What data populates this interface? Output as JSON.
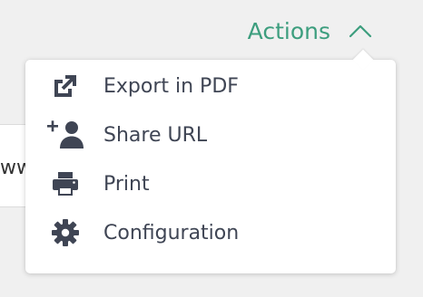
{
  "background": {
    "field_partial_text": "ww"
  },
  "actions": {
    "label": "Actions",
    "accent_color": "#3d9e7e",
    "chevron_icon": "chevron-up-icon"
  },
  "menu": {
    "items": [
      {
        "label": "Export in PDF",
        "icon": "external-link-icon"
      },
      {
        "label": "Share URL",
        "icon": "add-user-icon"
      },
      {
        "label": "Print",
        "icon": "printer-icon"
      },
      {
        "label": "Configuration",
        "icon": "gear-icon"
      }
    ],
    "icon_color": "#3f4554"
  }
}
